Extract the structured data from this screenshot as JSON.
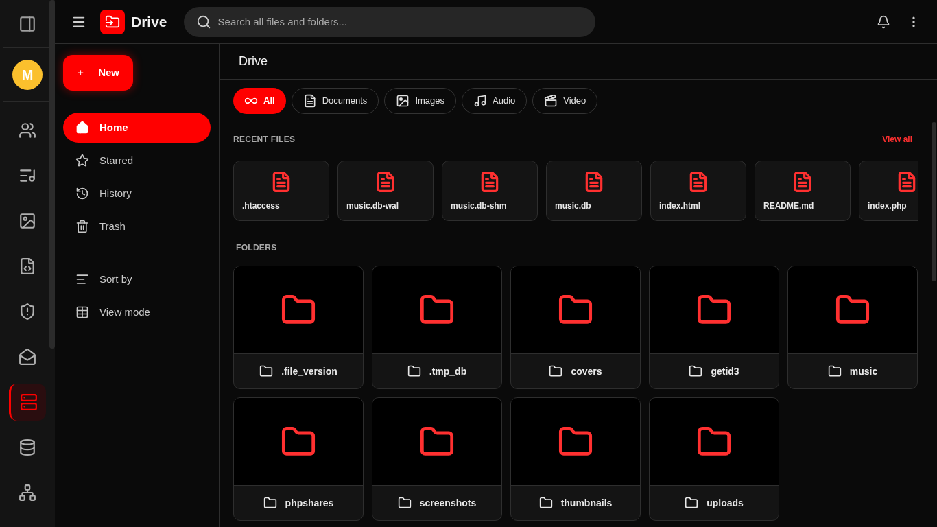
{
  "rail": {
    "avatar": "M",
    "items": [
      {
        "selected": false
      },
      {
        "selected": false
      },
      {
        "selected": false
      },
      {
        "selected": false
      },
      {
        "selected": false
      },
      {
        "selected": false
      },
      {
        "selected": true
      },
      {
        "selected": false
      },
      {
        "selected": false
      }
    ]
  },
  "header": {
    "title": "Drive",
    "search": {
      "placeholder": "Search all files and folders..."
    }
  },
  "sidebar": {
    "new_button": "New",
    "nav": [
      {
        "label": "Home",
        "selected": true
      },
      {
        "label": "Starred",
        "selected": false
      },
      {
        "label": "History",
        "selected": false
      },
      {
        "label": "Trash",
        "selected": false
      }
    ],
    "options": [
      "Sort by",
      "View mode"
    ]
  },
  "main": {
    "title": "Drive",
    "filters": [
      {
        "label": "All",
        "selected": true
      },
      {
        "label": "Documents",
        "selected": false
      },
      {
        "label": "Images",
        "selected": false
      },
      {
        "label": "Audio",
        "selected": false
      },
      {
        "label": "Video",
        "selected": false
      }
    ],
    "recent": {
      "heading": "RECENT FILES",
      "link": "View all",
      "files": [
        ".htaccess",
        "music.db-wal",
        "music.db-shm",
        "music.db",
        "index.html",
        "README.md",
        "index.php"
      ]
    },
    "folders": {
      "heading": "FOLDERS",
      "items": [
        ".file_version",
        ".tmp_db",
        "covers",
        "getid3",
        "music",
        "phpshares",
        "screenshots",
        "thumbnails",
        "uploads"
      ]
    }
  }
}
